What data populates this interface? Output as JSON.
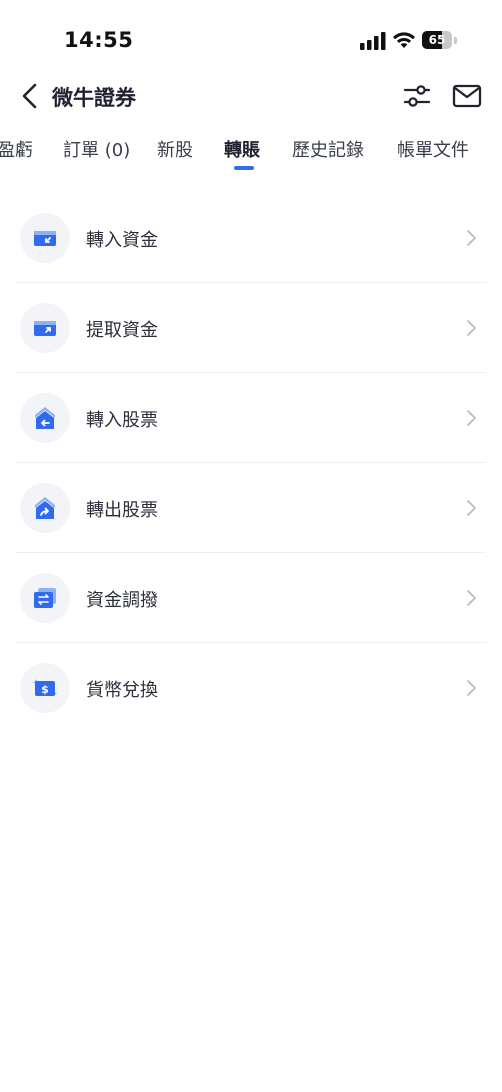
{
  "status": {
    "time": "14:55",
    "battery": "65",
    "battery_level": 0.65
  },
  "header": {
    "title": "微牛證券",
    "back_icon": "chevron-left-icon",
    "filter_icon": "sliders-icon",
    "mail_icon": "mail-icon"
  },
  "tabs": [
    {
      "label": "盈虧"
    },
    {
      "label": "訂單 (0)"
    },
    {
      "label": "新股"
    },
    {
      "label": "轉賬",
      "active": true
    },
    {
      "label": "歷史記錄"
    },
    {
      "label": "帳單文件"
    }
  ],
  "accent_color": "#2f6bec",
  "items": [
    {
      "label": "轉入資金",
      "icon": "wallet-in-icon"
    },
    {
      "label": "提取資金",
      "icon": "wallet-out-icon"
    },
    {
      "label": "轉入股票",
      "icon": "stock-in-icon"
    },
    {
      "label": "轉出股票",
      "icon": "stock-out-icon"
    },
    {
      "label": "資金調撥",
      "icon": "fund-transfer-icon"
    },
    {
      "label": "貨幣兌換",
      "icon": "currency-exchange-icon"
    }
  ]
}
